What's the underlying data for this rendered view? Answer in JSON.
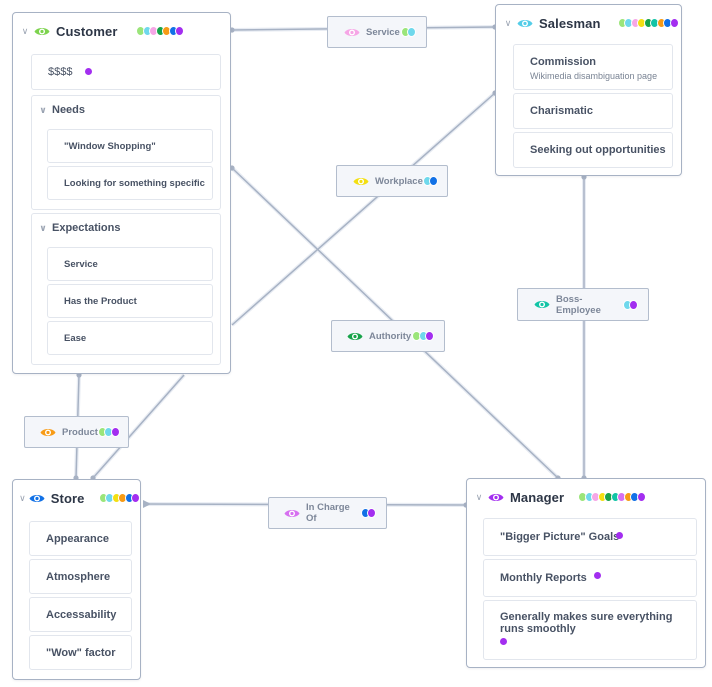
{
  "palette": {
    "light_green": "#9be57a",
    "light_cyan": "#6fd8ec",
    "pink": "#f6a6e6",
    "dark_green": "#17a34a",
    "orange": "#f79b16",
    "blue": "#1271e6",
    "purple": "#a32ef0",
    "yellow": "#f3df12",
    "teal": "#12c4a6",
    "violet": "#d670f0",
    "edge": "#a7b2c4"
  },
  "nodes": {
    "customer": {
      "title": "Customer",
      "eye_color": "#7dd34e",
      "tags": [
        "#9be57a",
        "#6fd8ec",
        "#f6a6e6",
        "#17a34a",
        "#f79b16",
        "#1271e6",
        "#a32ef0"
      ],
      "cards": [
        {
          "label": "$$$$",
          "dot": true
        }
      ],
      "groups": [
        {
          "title": "Needs",
          "items": [
            "\"Window Shopping\"",
            "Looking for something specific"
          ]
        },
        {
          "title": "Expectations",
          "items": [
            "Service",
            "Has the Product",
            "Ease"
          ]
        }
      ]
    },
    "salesman": {
      "title": "Salesman",
      "eye_color": "#54cde8",
      "tags": [
        "#9be57a",
        "#6fd8ec",
        "#f6a6e6",
        "#f3df12",
        "#17a34a",
        "#12c4a6",
        "#f79b16",
        "#1271e6",
        "#a32ef0"
      ],
      "cards": [
        {
          "label": "Commission",
          "sub": "Wikimedia disambiguation page"
        },
        {
          "label": "Charismatic"
        },
        {
          "label": "Seeking out opportunities"
        }
      ]
    },
    "store": {
      "title": "Store",
      "eye_color": "#1271e6",
      "tags": [
        "#9be57a",
        "#6fd8ec",
        "#f3df12",
        "#f79b16",
        "#1271e6",
        "#a32ef0"
      ],
      "cards": [
        {
          "label": "Appearance"
        },
        {
          "label": "Atmosphere"
        },
        {
          "label": "Accessability"
        },
        {
          "label": "\"Wow\" factor"
        }
      ]
    },
    "manager": {
      "title": "Manager",
      "eye_color": "#a32ef0",
      "tags": [
        "#9be57a",
        "#6fd8ec",
        "#f6a6e6",
        "#f3df12",
        "#17a34a",
        "#12c4a6",
        "#d670f0",
        "#f79b16",
        "#1271e6",
        "#a32ef0"
      ],
      "cards": [
        {
          "label": "\"Bigger Picture\" Goals",
          "dot": true
        },
        {
          "label": "Monthly Reports",
          "dot": true
        },
        {
          "label": "Generally makes sure everything runs smoothly",
          "dot": true
        }
      ]
    }
  },
  "relations": {
    "service": {
      "label": "Service",
      "eye_color": "#f6a6e6",
      "tags": [
        "#9be57a",
        "#6fd8ec"
      ]
    },
    "workplace": {
      "label": "Workplace",
      "eye_color": "#f3df12",
      "tags": [
        "#6fd8ec",
        "#1271e6"
      ]
    },
    "authority": {
      "label": "Authority",
      "eye_color": "#17a34a",
      "tags": [
        "#9be57a",
        "#6fd8ec",
        "#a32ef0"
      ]
    },
    "boss_employee": {
      "label": "Boss-Employee",
      "eye_color": "#12c4a6",
      "tags": [
        "#6fd8ec",
        "#a32ef0"
      ]
    },
    "product": {
      "label": "Product",
      "eye_color": "#f79b16",
      "tags": [
        "#9be57a",
        "#6fd8ec",
        "#a32ef0"
      ]
    },
    "in_charge_of": {
      "label": "In Charge Of",
      "eye_color": "#d670f0",
      "tags": [
        "#1271e6",
        "#a32ef0"
      ]
    }
  }
}
